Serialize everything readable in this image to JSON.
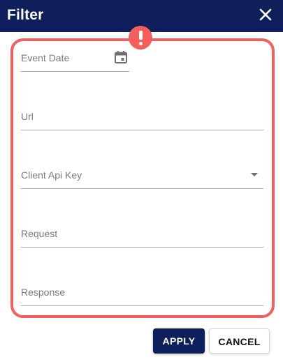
{
  "dialog": {
    "title": "Filter",
    "close_icon": "close-icon"
  },
  "fields": {
    "event_date": {
      "placeholder": "Event Date",
      "icon": "calendar-icon"
    },
    "url": {
      "placeholder": "Url"
    },
    "client_api_key": {
      "placeholder": "Client Api Key",
      "icon": "dropdown-arrow-icon"
    },
    "request": {
      "placeholder": "Request"
    },
    "response": {
      "placeholder": "Response"
    }
  },
  "highlight": {
    "color": "#f25f5c",
    "icon": "alert-exclamation-icon"
  },
  "actions": {
    "apply_label": "APPLY",
    "cancel_label": "CANCEL"
  },
  "colors": {
    "header_bg": "#0f1f5c",
    "accent": "#0f1f5c"
  }
}
